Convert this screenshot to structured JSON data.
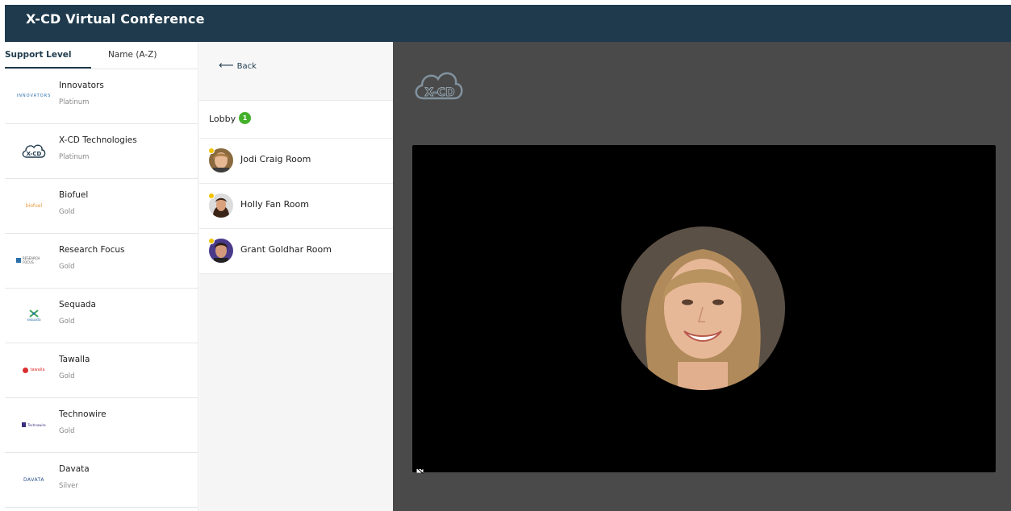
{
  "app": {
    "title": "X-CD Virtual Conference"
  },
  "sponsors": {
    "tabs": [
      "Support Level",
      "Name (A-Z)"
    ],
    "items": [
      {
        "name": "Innovators",
        "level": "Platinum",
        "logo": "INNOVATORS"
      },
      {
        "name": "X-CD Technologies",
        "level": "Platinum",
        "logo": "X-CD"
      },
      {
        "name": "Biofuel",
        "level": "Gold",
        "logo": "biofuel"
      },
      {
        "name": "Research Focus",
        "level": "Gold",
        "logo": "RESEARCH FOCUS"
      },
      {
        "name": "Sequada",
        "level": "Gold",
        "logo": "sequada"
      },
      {
        "name": "Tawalla",
        "level": "Gold",
        "logo": "tawalla"
      },
      {
        "name": "Technowire",
        "level": "Gold",
        "logo": "Technowire"
      },
      {
        "name": "Davata",
        "level": "Silver",
        "logo": "DAVATA"
      }
    ]
  },
  "rooms": {
    "back_label": "Back",
    "lobby": {
      "label": "Lobby",
      "count": "1"
    },
    "items": [
      {
        "label": "Jodi Craig Room"
      },
      {
        "label": "Holly Fan Room"
      },
      {
        "label": "Grant Goldhar Room"
      }
    ]
  },
  "main": {
    "brand_logo": "X-CD",
    "camera_icon": "camera-off-icon"
  },
  "colors": {
    "header": "#1e3a4c",
    "accent": "#1e3a4c",
    "badge": "#43b02a",
    "status_dot": "#f2c300",
    "main_bg": "#4a4a4a"
  }
}
